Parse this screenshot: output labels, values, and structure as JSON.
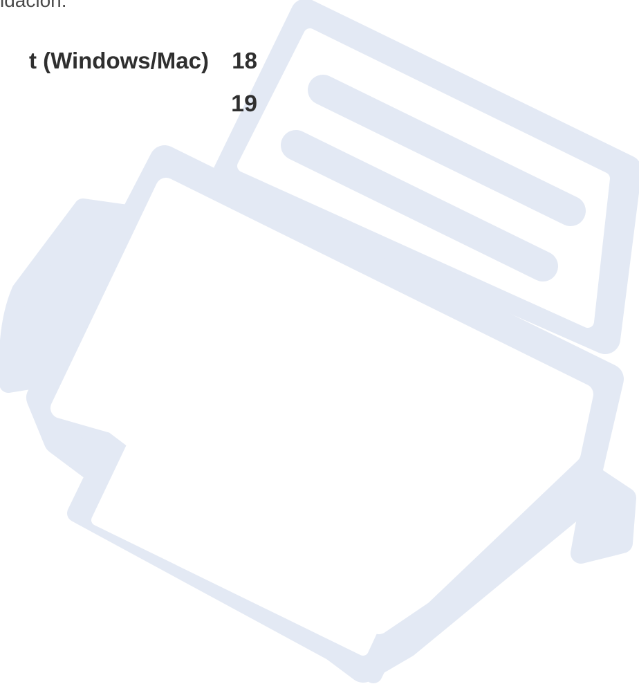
{
  "intro": {
    "text": "idacion."
  },
  "toc": {
    "entries": [
      {
        "title": "t (Windows/Mac)",
        "page": "18"
      },
      {
        "title": "",
        "page": "19"
      }
    ]
  },
  "illustration": {
    "icon": "printer-icon",
    "color": "#e3e9f4"
  }
}
